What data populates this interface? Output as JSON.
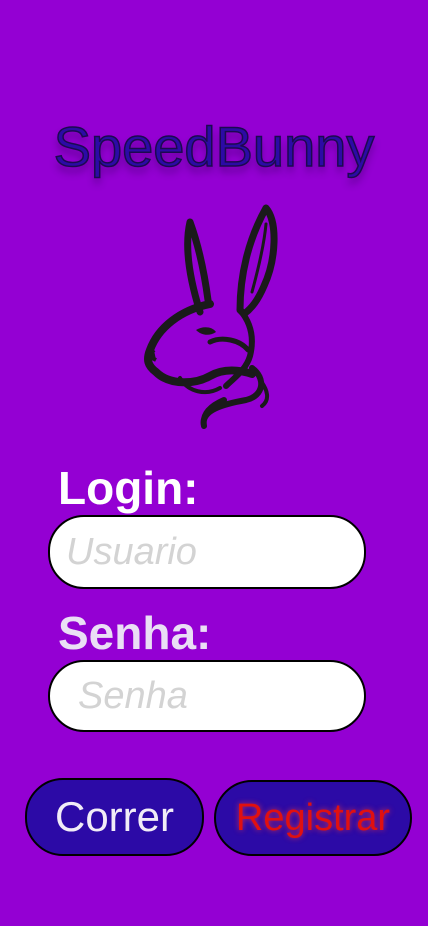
{
  "app": {
    "title": "SpeedBunny",
    "logo_icon": "rabbit-icon",
    "background_color": "#9400d3",
    "accent_color": "#2c0aa6"
  },
  "login": {
    "label": "Login:",
    "value": "",
    "placeholder": "Usuario"
  },
  "password": {
    "label": "Senha:",
    "value": "",
    "placeholder": "Senha"
  },
  "buttons": {
    "run_label": "Correr",
    "register_label": "Registrar",
    "register_text_color": "#e01010"
  }
}
